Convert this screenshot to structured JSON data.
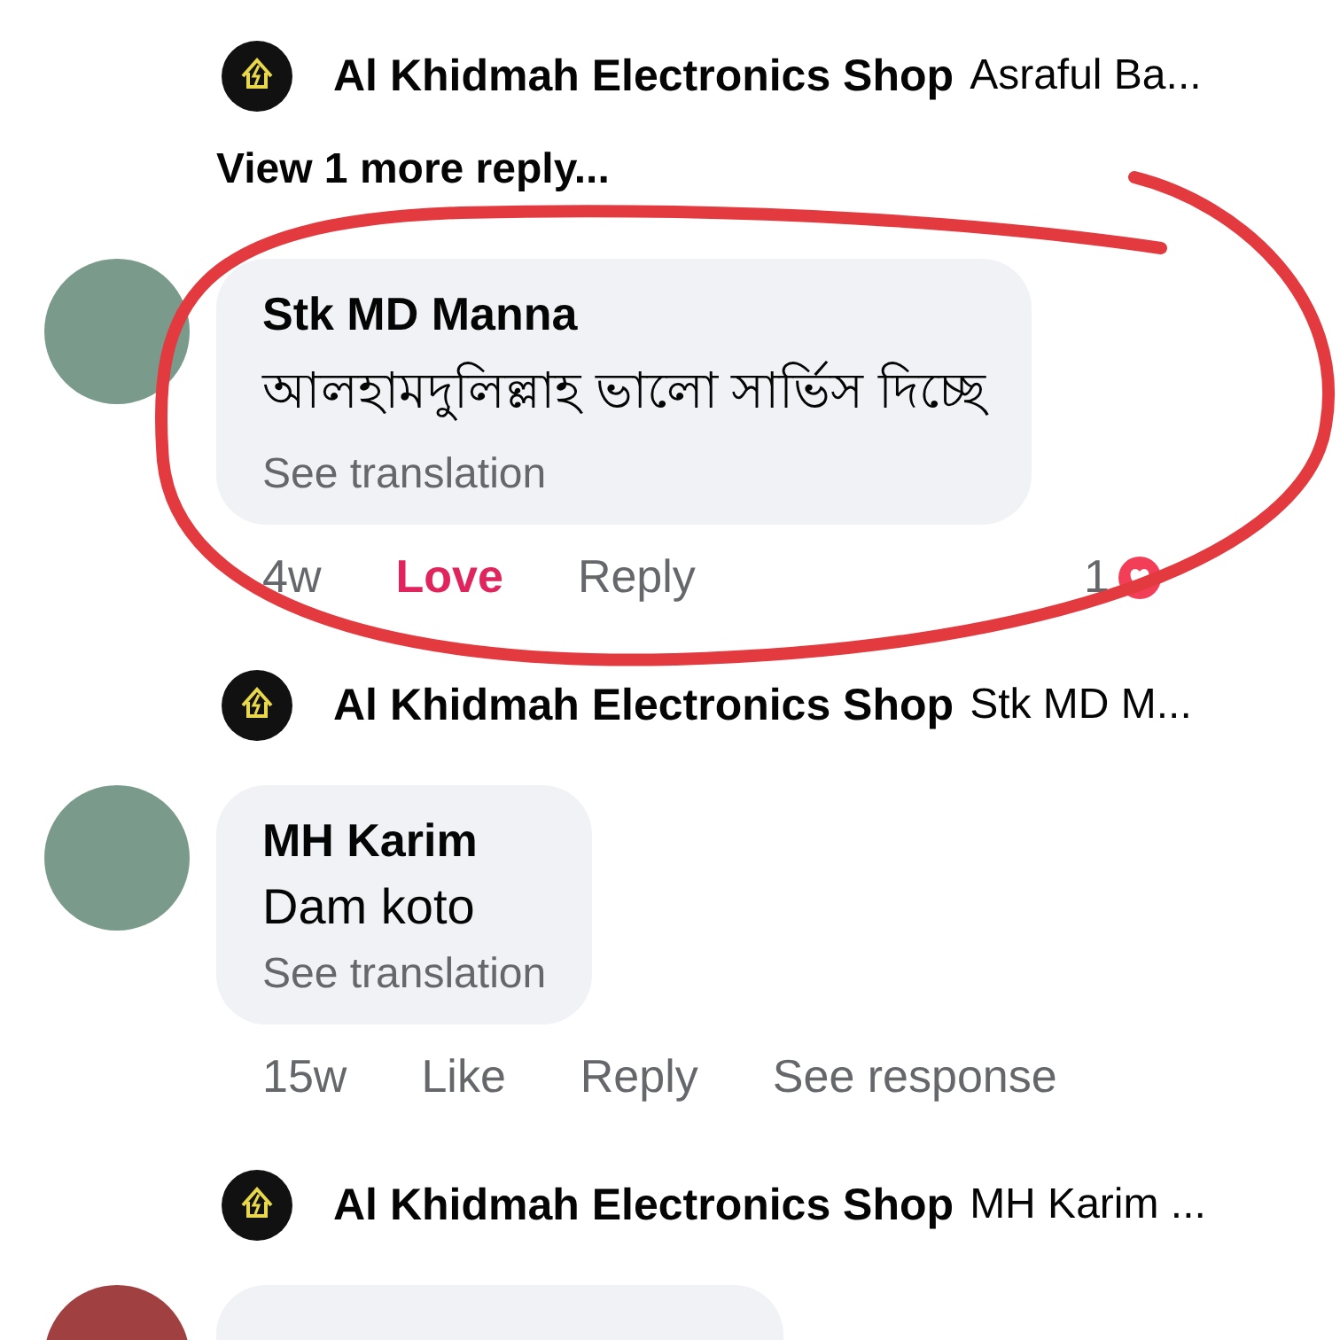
{
  "items": [
    {
      "kind": "reply_preview",
      "page": "Al Khidmah Electronics Shop",
      "text": "Asraful Ba..."
    },
    {
      "kind": "view_more",
      "text": "View 1 more reply..."
    },
    {
      "kind": "comment",
      "author": "Stk MD Manna",
      "text": "আলহামদুলিল্লাহ ভালো সার্ভিস দিচ্ছে",
      "translation": "See translation",
      "time": "4w",
      "reaction": {
        "label": "Love",
        "selected": true
      },
      "reply": "Reply",
      "reaction_count": "1"
    },
    {
      "kind": "reply_preview",
      "page": "Al Khidmah Electronics Shop",
      "text": "Stk MD M..."
    },
    {
      "kind": "comment",
      "author": "MH Karim",
      "text": "Dam koto",
      "translation": "See translation",
      "time": "15w",
      "reaction": {
        "label": "Like",
        "selected": false
      },
      "reply": "Reply",
      "extra_link": "See response"
    },
    {
      "kind": "reply_preview",
      "page": "Al Khidmah Electronics Shop",
      "text": "MH Karim ..."
    },
    {
      "kind": "partial_comment"
    }
  ]
}
